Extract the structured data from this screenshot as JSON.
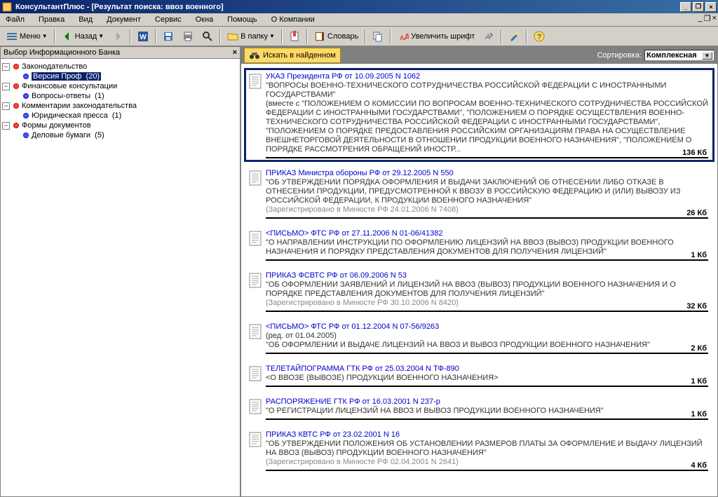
{
  "window": {
    "title": "КонсультантПлюс - [Результат поиска: ввоз военного]"
  },
  "menu": {
    "file": "Файл",
    "edit": "Правка",
    "view": "Вид",
    "document": "Документ",
    "service": "Сервис",
    "windows": "Окна",
    "help": "Помощь",
    "about": "О Компании"
  },
  "toolbar": {
    "menu_btn": "Меню",
    "back_btn": "Назад",
    "folder_btn": "В папку",
    "dict_btn": "Словарь",
    "zoom_btn": "Увеличить шрифт"
  },
  "sidebar": {
    "title": "Выбор Информационного Банка",
    "nodes": [
      {
        "label": "Законодательство",
        "children": [
          {
            "label": "Версия Проф",
            "count": "(20)",
            "selected": true
          }
        ]
      },
      {
        "label": "Финансовые консультации",
        "children": [
          {
            "label": "Вопросы-ответы",
            "count": "(1)"
          }
        ]
      },
      {
        "label": "Комментарии законодательства",
        "children": [
          {
            "label": "Юридическая пресса",
            "count": "(1)"
          }
        ]
      },
      {
        "label": "Формы документов",
        "children": [
          {
            "label": "Деловые бумаги",
            "count": "(5)"
          }
        ]
      }
    ]
  },
  "content": {
    "find_btn": "Искать в найденном",
    "sort_label": "Сортировка:",
    "sort_value": "Комплексная"
  },
  "results": [
    {
      "title": "УКАЗ Президента РФ от 10.09.2005 N 1062",
      "text": "\"ВОПРОСЫ ВОЕННО-ТЕХНИЧЕСКОГО СОТРУДНИЧЕСТВА РОССИЙСКОЙ ФЕДЕРАЦИИ С ИНОСТРАННЫМИ ГОСУДАРСТВАМИ\"\n(вместе с \"ПОЛОЖЕНИЕМ О КОМИССИИ ПО ВОПРОСАМ ВОЕННО-ТЕХНИЧЕСКОГО СОТРУДНИЧЕСТВА РОССИЙСКОЙ ФЕДЕРАЦИИ С ИНОСТРАННЫМИ ГОСУДАРСТВАМИ\", \"ПОЛОЖЕНИЕМ О ПОРЯДКЕ ОСУЩЕСТВЛЕНИЯ ВОЕННО-ТЕХНИЧЕСКОГО СОТРУДНИЧЕСТВА РОССИЙСКОЙ ФЕДЕРАЦИИ С ИНОСТРАННЫМИ ГОСУДАРСТВАМИ\", \"ПОЛОЖЕНИЕМ О ПОРЯДКЕ ПРЕДОСТАВЛЕНИЯ РОССИЙСКИМ ОРГАНИЗАЦИЯМ ПРАВА НА ОСУЩЕСТВЛЕНИЕ ВНЕШНЕТОРГОВОЙ ДЕЯТЕЛЬНОСТИ В ОТНОШЕНИИ ПРОДУКЦИИ ВОЕННОГО НАЗНАЧЕНИЯ\", \"ПОЛОЖЕНИЕМ О ПОРЯДКЕ РАССМОТРЕНИЯ ОБРАЩЕНИЙ ИНОСТР...",
      "size": "136 Кб",
      "selected": true
    },
    {
      "title": "ПРИКАЗ Министра обороны РФ от 29.12.2005 N 550",
      "text": "\"ОБ УТВЕРЖДЕНИИ ПОРЯДКА ОФОРМЛЕНИЯ И ВЫДАЧИ ЗАКЛЮЧЕНИЙ ОБ ОТНЕСЕНИИ ЛИБО ОТКАЗЕ В ОТНЕСЕНИИ ПРОДУКЦИИ, ПРЕДУСМОТРЕННОЙ К ВВОЗУ В РОССИЙСКУЮ ФЕДЕРАЦИЮ И (ИЛИ) ВЫВОЗУ ИЗ РОССИЙСКОЙ ФЕДЕРАЦИИ, К ПРОДУКЦИИ ВОЕННОГО НАЗНАЧЕНИЯ\"",
      "reg": "(Зарегистрировано в Минюсте РФ 24.01.2006 N 7408)",
      "size": "26 Кб"
    },
    {
      "title": "<ПИСЬМО> ФТС РФ от 27.11.2006 N 01-06/41382",
      "text": "\"О НАПРАВЛЕНИИ ИНСТРУКЦИИ ПО ОФОРМЛЕНИЮ ЛИЦЕНЗИЙ НА ВВОЗ (ВЫВОЗ) ПРОДУКЦИИ ВОЕННОГО НАЗНАЧЕНИЯ И ПОРЯДКУ ПРЕДСТАВЛЕНИЯ ДОКУМЕНТОВ ДЛЯ ПОЛУЧЕНИЯ ЛИЦЕНЗИЙ\"",
      "size": "1 Кб"
    },
    {
      "title": "ПРИКАЗ ФСВТС РФ от 06.09.2006 N 53",
      "text": "\"ОБ ОФОРМЛЕНИИ ЗАЯВЛЕНИЙ И ЛИЦЕНЗИЙ НА ВВОЗ (ВЫВОЗ) ПРОДУКЦИИ ВОЕННОГО НАЗНАЧЕНИЯ И О ПОРЯДКЕ ПРЕДСТАВЛЕНИЯ ДОКУМЕНТОВ ДЛЯ ПОЛУЧЕНИЯ ЛИЦЕНЗИЙ\"",
      "reg": "(Зарегистрировано в Минюсте РФ 30.10.2006 N 8420)",
      "size": "32 Кб"
    },
    {
      "title": "<ПИСЬМО> ФТС РФ от 01.12.2004 N 07-56/9263",
      "pre": "(ред. от 01.04.2005)",
      "text": "\"ОБ ОФОРМЛЕНИИ И ВЫДАЧЕ ЛИЦЕНЗИЙ НА ВВОЗ И ВЫВОЗ ПРОДУКЦИИ ВОЕННОГО НАЗНАЧЕНИЯ\"",
      "size": "2 Кб"
    },
    {
      "title": "ТЕЛЕТАЙПОГРАММА ГТК РФ от 25.03.2004 N ТФ-890",
      "text": "<О ВВОЗЕ (ВЫВОЗЕ) ПРОДУКЦИИ ВОЕННОГО НАЗНАЧЕНИЯ>",
      "size": "1 Кб"
    },
    {
      "title": "РАСПОРЯЖЕНИЕ ГТК РФ от 16.03.2001 N 237-р",
      "text": "\"О РЕГИСТРАЦИИ ЛИЦЕНЗИЙ НА ВВОЗ И ВЫВОЗ ПРОДУКЦИИ ВОЕННОГО НАЗНАЧЕНИЯ\"",
      "size": "1 Кб"
    },
    {
      "title": "ПРИКАЗ КВТС РФ от 23.02.2001 N 16",
      "text": "\"ОБ УТВЕРЖДЕНИИ ПОЛОЖЕНИЯ ОБ УСТАНОВЛЕНИИ РАЗМЕРОВ ПЛАТЫ ЗА ОФОРМЛЕНИЕ И ВЫДАЧУ ЛИЦЕНЗИЙ НА ВВОЗ (ВЫВОЗ) ПРОДУКЦИИ ВОЕННОГО НАЗНАЧЕНИЯ\"",
      "reg": "(Зарегистрировано в Минюсте РФ 02.04.2001 N 2641)",
      "size": "4 Кб"
    }
  ]
}
